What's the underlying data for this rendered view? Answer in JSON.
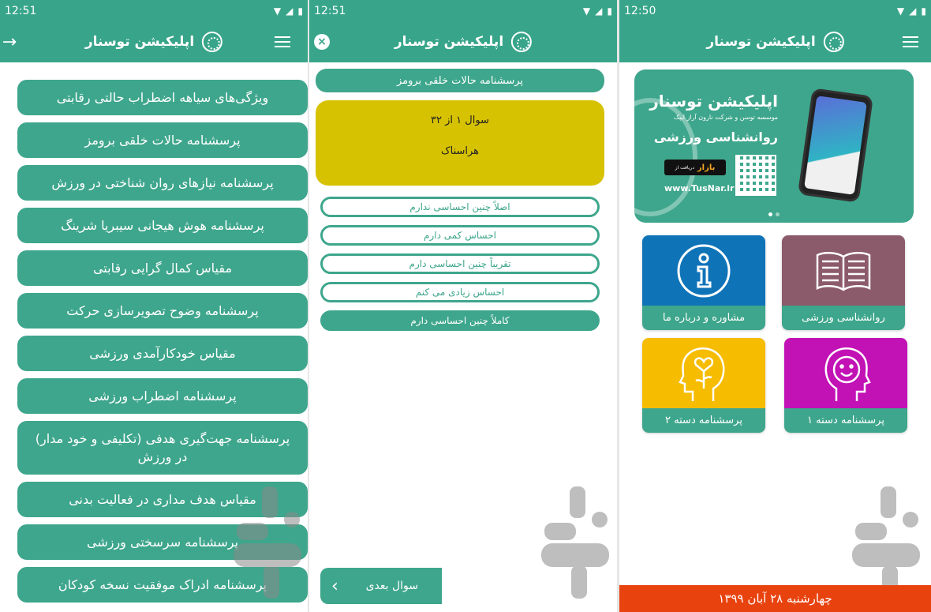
{
  "status": {
    "time_1": "12:51",
    "time_2": "12:51",
    "time_3": "12:50"
  },
  "app_title": "اپلیکیشن توسنار",
  "screen1": {
    "items": [
      "ویژگی‌های سیاهه اضطراب حالتی رقابتی",
      "پرسشنامه حالات خلقی برومز",
      "پرسشنامه نیازهای روان شناختی در ورزش",
      "پرسشنامه هوش هیجانی سیبریا شرینگ",
      "مقیاس کمال گرایی رقابتی",
      "پرسشنامه وضوح تصویرسازی حرکت",
      "مقیاس خودکارآمدی ورزشی",
      "پرسشنامه اضطراب ورزشی",
      "پرسشنامه جهت‌گیری هدفی (تکلیفی و خود مدار) در ورزش",
      "مقیاس هدف مداری در فعالیت بدنی",
      "پرسشنامه سرسختی ورزشی",
      "پرسشنامه ادراک موفقیت نسخه کودکان"
    ]
  },
  "screen2": {
    "questionnaire_title": "پرسشنامه حالات خلقی برومز",
    "question_counter": "سوال ۱ از ۳۲",
    "question_text": "هراسناک",
    "answers": [
      "اصلاً چنین احساسی ندارم",
      "احساس کمی دارم",
      "تقریباً چنین احساسی دارم",
      "احساس زیادی می کنم",
      "کاملاً چنین احساسی دارم"
    ],
    "next_label": "سوال بعدی",
    "next_icon": "‹"
  },
  "screen3": {
    "banner": {
      "title": "اپلیکیشن توسنار",
      "subtitle": "موسسه توسن و شرکت نارون آراز ایپک",
      "category": "روانشناسی ورزشی",
      "store_prefix": "دریافت از",
      "store_name": "بازار",
      "website": "www.TusNar.ir"
    },
    "tiles": [
      {
        "label": "روانشناسی ورزشی",
        "color": "#8b5a6b",
        "icon": "book-icon"
      },
      {
        "label": "مشاوره و درباره ما",
        "color": "#0f73b8",
        "icon": "info-icon"
      },
      {
        "label": "پرسشنامه دسته ۱",
        "color": "#c211b5",
        "icon": "smile-head-icon"
      },
      {
        "label": "پرسشنامه دسته ۲",
        "color": "#f6bc00",
        "icon": "plant-head-icon"
      }
    ],
    "date": "چهارشنبه ۲۸ آبان ۱۳۹۹"
  },
  "colors": {
    "primary": "#38a58a",
    "button": "#3ea68c",
    "question_card": "#d6c200",
    "date_bar": "#e8430f"
  }
}
